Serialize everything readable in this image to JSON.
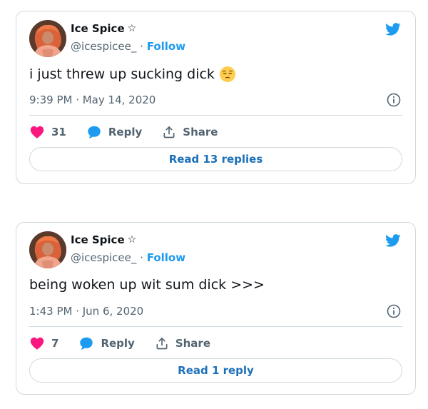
{
  "colors": {
    "accent": "#1d9bf0",
    "heart": "#f91880",
    "muted": "#536471",
    "border": "#cfd9de"
  },
  "tweets": [
    {
      "author_name": "Ice Spice",
      "badge": "☆",
      "handle": "@icespicee_",
      "separator": "·",
      "follow_label": "Follow",
      "text": "i just threw up sucking dick",
      "emoji": "pensive-face-emoji",
      "timestamp": "9:39 PM · May 14, 2020",
      "likes": "31",
      "reply_label": "Reply",
      "share_label": "Share",
      "read_replies_label": "Read 13 replies"
    },
    {
      "author_name": "Ice Spice",
      "badge": "☆",
      "handle": "@icespicee_",
      "separator": "·",
      "follow_label": "Follow",
      "text": "being woken up wit sum dick >>>",
      "timestamp": "1:43 PM · Jun 6, 2020",
      "likes": "7",
      "reply_label": "Reply",
      "share_label": "Share",
      "read_replies_label": "Read 1 reply"
    }
  ]
}
